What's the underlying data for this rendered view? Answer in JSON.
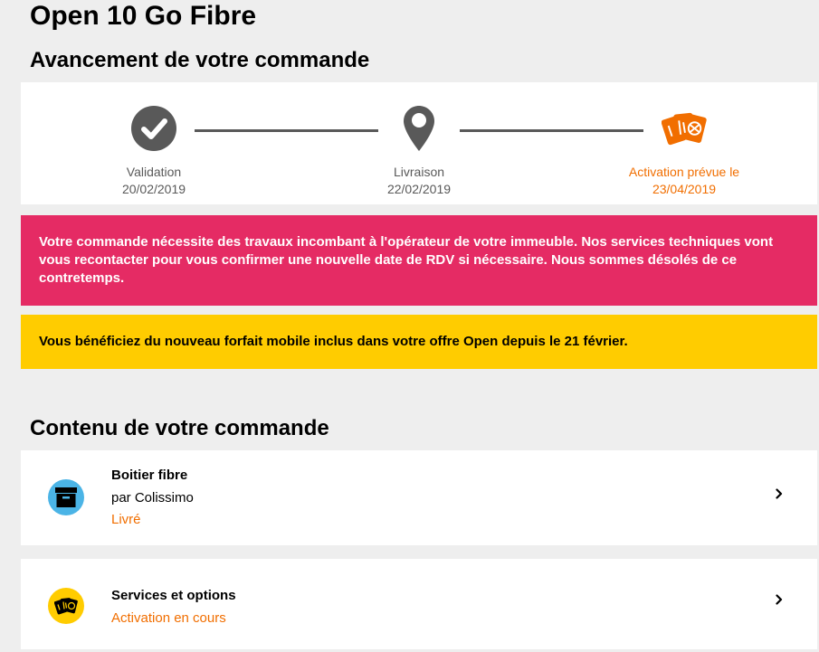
{
  "page": {
    "title": "Open 10 Go Fibre"
  },
  "progress": {
    "title": "Avancement de votre commande",
    "steps": [
      {
        "label": "Validation",
        "date": "20/02/2019",
        "icon": "check-circle-icon",
        "state": "done"
      },
      {
        "label": "Livraison",
        "date": "22/02/2019",
        "icon": "map-pin-icon",
        "state": "done"
      },
      {
        "label": "Activation prévue le",
        "date": "23/04/2019",
        "icon": "sim-cards-icon",
        "state": "current"
      }
    ]
  },
  "alerts": {
    "pink": "Votre commande nécessite des travaux incombant à l'opérateur de votre immeuble. Nos services techniques vont vous recontacter pour vous confirmer une nouvelle date de RDV si nécessaire. Nous sommes désolés de ce contretemps.",
    "yellow": "Vous bénéficiez du nouveau forfait mobile inclus dans votre offre Open depuis le 21 février."
  },
  "content": {
    "title": "Contenu de votre commande",
    "items": [
      {
        "title": "Boitier fibre",
        "subtitle": "par Colissimo",
        "status": "Livré",
        "icon": "box-icon"
      },
      {
        "title": "Services et options",
        "status": "Activation en cours",
        "icon": "sim-cards-icon"
      }
    ]
  },
  "colors": {
    "orange": "#f16e00",
    "pink": "#e52b64",
    "yellow": "#ffcc00",
    "blue": "#4bb4e6",
    "grey": "#595959"
  }
}
